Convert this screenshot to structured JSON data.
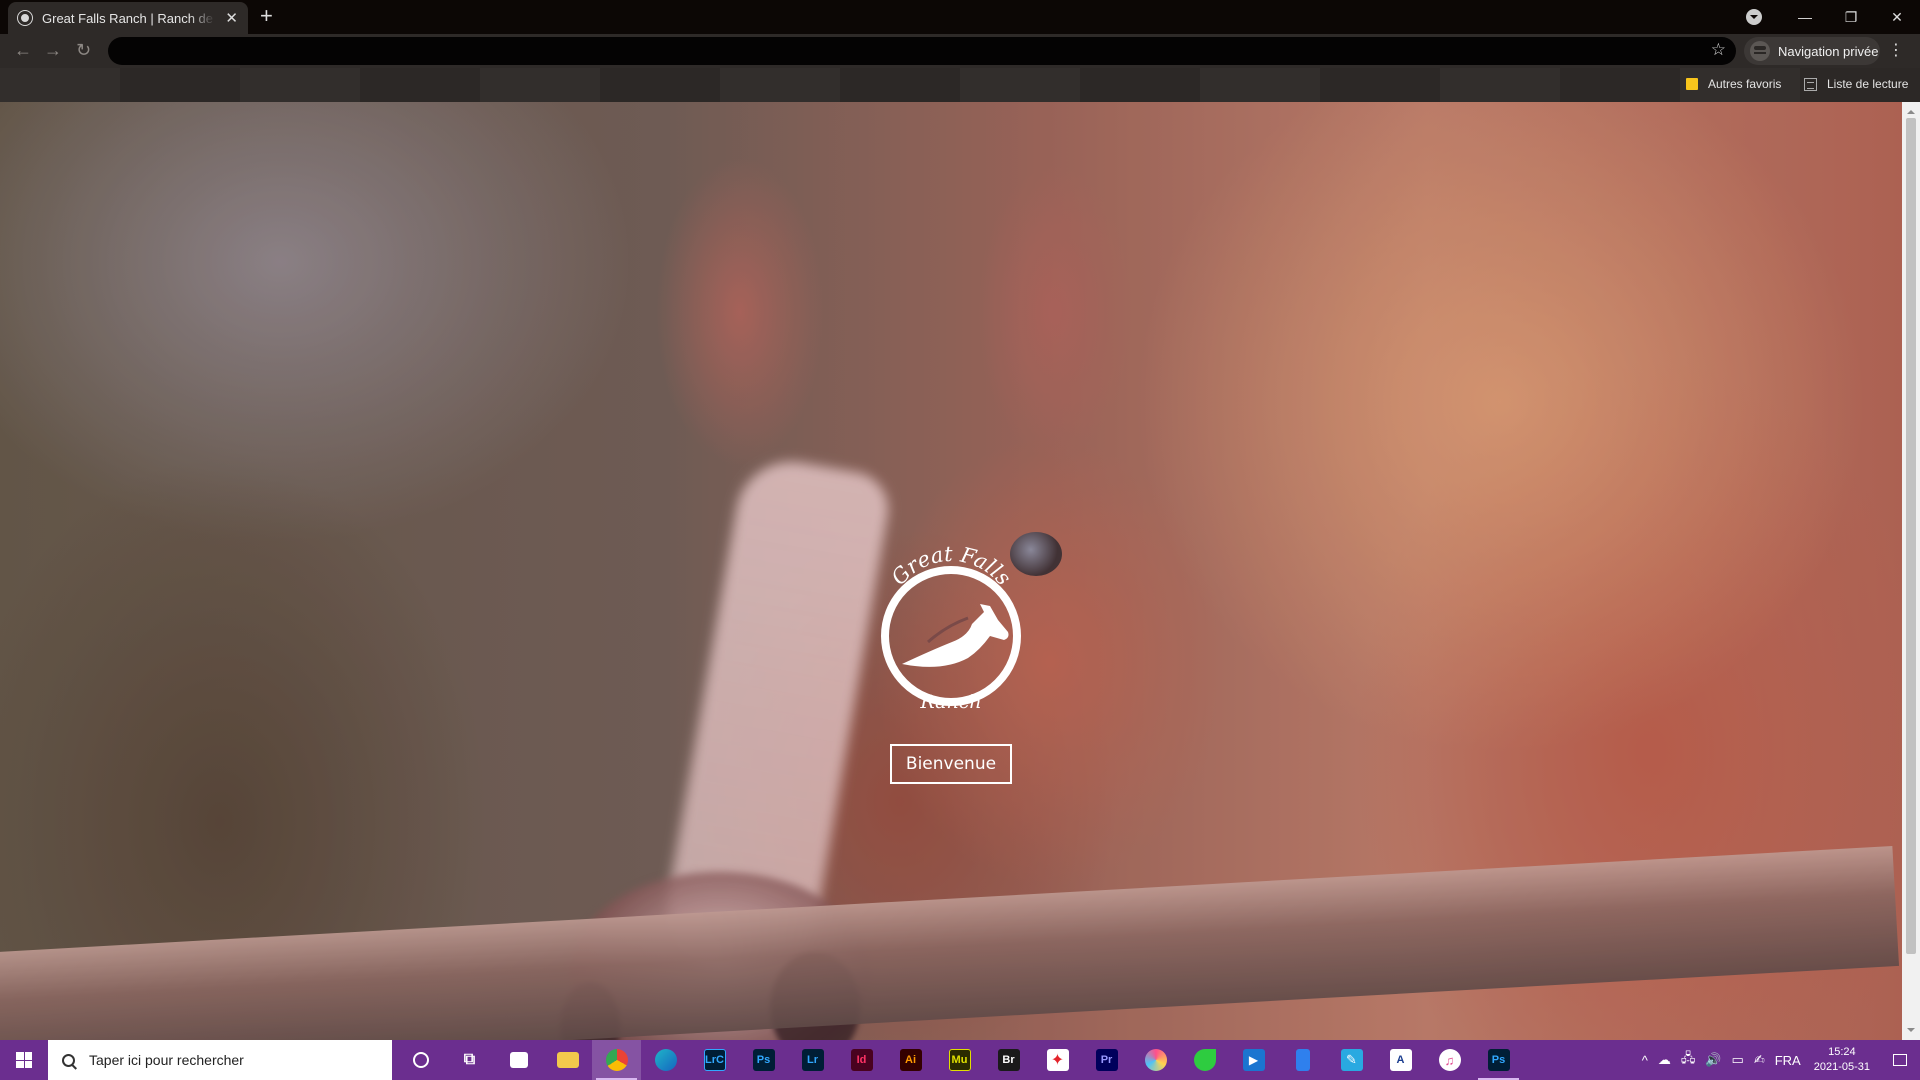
{
  "browser": {
    "tab_title": "Great Falls Ranch | Ranch de ranch",
    "incognito_label": "Navigation privée",
    "bookmarks": [
      {
        "label": "Autres favoris",
        "icon": "folder-icon"
      },
      {
        "label": "Liste de lecture",
        "icon": "reading-list-icon"
      }
    ]
  },
  "page": {
    "logo": {
      "top_text": "Great Falls",
      "bottom_text": "Ranch"
    },
    "welcome_button": "Bienvenue"
  },
  "taskbar": {
    "search_placeholder": "Taper ici pour rechercher",
    "apps": [
      {
        "name": "cortana",
        "label": ""
      },
      {
        "name": "task-view",
        "label": ""
      },
      {
        "name": "store",
        "label": ""
      },
      {
        "name": "file-explorer",
        "label": ""
      },
      {
        "name": "chrome",
        "label": ""
      },
      {
        "name": "edge",
        "label": ""
      },
      {
        "name": "lightroom-classic",
        "label": "LrC"
      },
      {
        "name": "photoshop",
        "label": "Ps"
      },
      {
        "name": "lightroom",
        "label": "Lr"
      },
      {
        "name": "indesign",
        "label": "Id"
      },
      {
        "name": "illustrator",
        "label": "Ai"
      },
      {
        "name": "muse",
        "label": "Mu"
      },
      {
        "name": "bridge",
        "label": "Br"
      },
      {
        "name": "acrobat",
        "label": ""
      },
      {
        "name": "premiere",
        "label": "Pr"
      },
      {
        "name": "app-colorful",
        "label": ""
      },
      {
        "name": "app-green",
        "label": ""
      },
      {
        "name": "app-zoom",
        "label": ""
      },
      {
        "name": "app-blue-doc",
        "label": ""
      },
      {
        "name": "app-notes",
        "label": ""
      },
      {
        "name": "app-a",
        "label": ""
      },
      {
        "name": "itunes",
        "label": ""
      },
      {
        "name": "photoshop-running",
        "label": "Ps"
      }
    ],
    "language": "FRA",
    "time": "15:24",
    "date": "2021-05-31"
  }
}
